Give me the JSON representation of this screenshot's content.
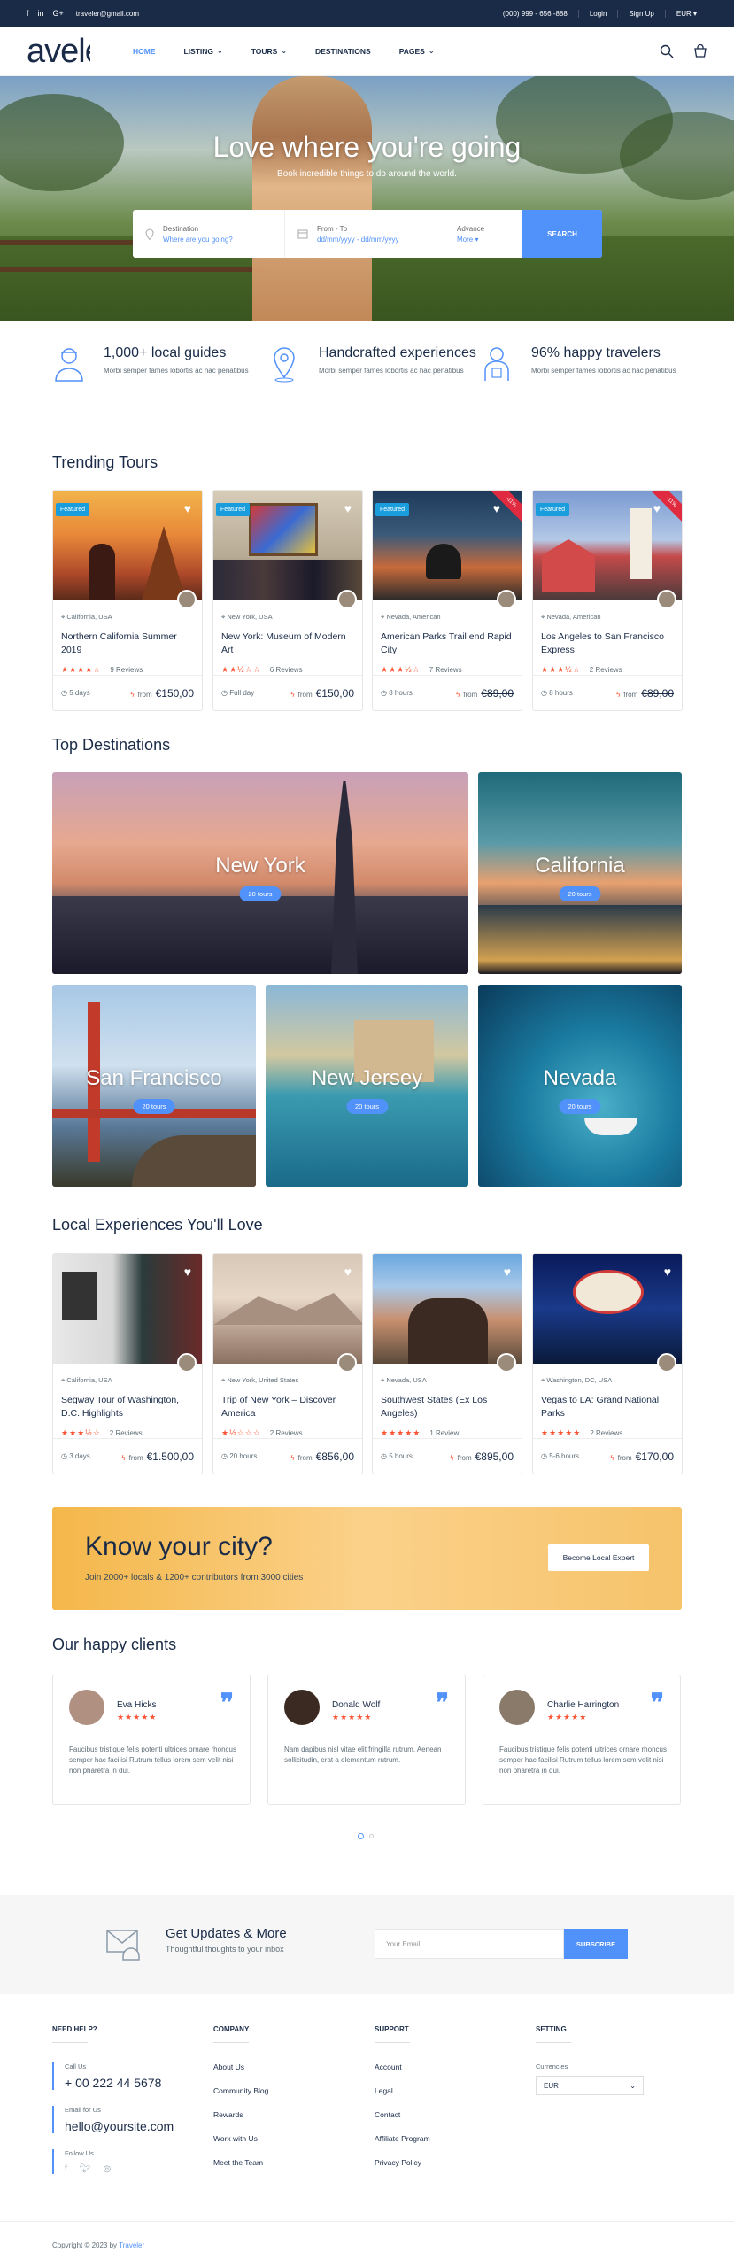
{
  "topbar": {
    "email": "traveler@gmail.com",
    "phone": "(000) 999 - 656 -888",
    "login": "Login",
    "signup": "Sign Up",
    "currency": "EUR"
  },
  "header": {
    "logo": "aveler",
    "nav": [
      "HOME",
      "LISTING",
      "TOURS",
      "DESTINATIONS",
      "PAGES"
    ]
  },
  "hero": {
    "title": "Love where you're going",
    "subtitle": "Book incredible things to do around the world.",
    "destination_label": "Destination",
    "destination_value": "Where are you going?",
    "date_label": "From - To",
    "date_value": "dd/mm/yyyy - dd/mm/yyyy",
    "advance_label": "Advance",
    "advance_value": "More",
    "search_button": "SEARCH"
  },
  "features": [
    {
      "title": "1,000+ local guides",
      "text": "Morbi semper fames lobortis ac hac penatibus"
    },
    {
      "title": "Handcrafted experiences",
      "text": "Morbi semper fames lobortis ac hac penatibus"
    },
    {
      "title": "96% happy travelers",
      "text": "Morbi semper fames lobortis ac hac penatibus"
    }
  ],
  "trending": {
    "title": "Trending Tours",
    "cards": [
      {
        "badge": "Featured",
        "location": "California, USA",
        "name": "Northern California Summer 2019",
        "reviews": "9 Reviews",
        "duration": "5 days",
        "from": "from",
        "price": "€150,00",
        "rating": 4
      },
      {
        "badge": "Featured",
        "location": "New York, USA",
        "name": "New York: Museum of Modern Art",
        "reviews": "6 Reviews",
        "duration": "Full day",
        "from": "from",
        "price": "€150,00",
        "rating": 2.5
      },
      {
        "badge": "Featured",
        "location": "Nevada, American",
        "name": "American Parks Trail end Rapid City",
        "reviews": "7 Reviews",
        "duration": "8 hours",
        "from": "from",
        "price": "€89,00",
        "rating": 3.5,
        "sale": "-11%"
      },
      {
        "badge": "Featured",
        "location": "Nevada, American",
        "name": "Los Angeles to San Francisco Express",
        "reviews": "2 Reviews",
        "duration": "8 hours",
        "from": "from",
        "price": "€89,00",
        "rating": 3.5,
        "sale": "-11%"
      }
    ]
  },
  "destinations": {
    "title": "Top Destinations",
    "items": [
      {
        "name": "New York",
        "tours": "20 tours"
      },
      {
        "name": "California",
        "tours": "20 tours"
      },
      {
        "name": "San Francisco",
        "tours": "20 tours"
      },
      {
        "name": "New Jersey",
        "tours": "20 tours"
      },
      {
        "name": "Nevada",
        "tours": "20 tours"
      }
    ]
  },
  "experiences": {
    "title": "Local Experiences You'll Love",
    "cards": [
      {
        "location": "California, USA",
        "name": "Segway Tour of Washington, D.C. Highlights",
        "reviews": "2 Reviews",
        "duration": "3 days",
        "from": "from",
        "price": "€1.500,00",
        "rating": 3.5
      },
      {
        "location": "New York, United States",
        "name": "Trip of New York – Discover America",
        "reviews": "2 Reviews",
        "duration": "20 hours",
        "from": "from",
        "price": "€856,00",
        "rating": 1.5
      },
      {
        "location": "Nevada, USA",
        "name": "Southwest States (Ex Los Angeles)",
        "reviews": "1 Review",
        "duration": "5 hours",
        "from": "from",
        "price": "€895,00",
        "rating": 5
      },
      {
        "location": "Washington, DC, USA",
        "name": "Vegas to LA: Grand National Parks",
        "reviews": "2 Reviews",
        "duration": "5-6 hours",
        "from": "from",
        "price": "€170,00",
        "rating": 5
      }
    ]
  },
  "banner": {
    "title": "Know your city?",
    "text": "Join 2000+ locals & 1200+ contributors from 3000 cities",
    "button": "Become Local Expert"
  },
  "clients": {
    "title": "Our happy clients",
    "items": [
      {
        "name": "Eva Hicks",
        "text": "Faucibus tristique felis potenti ultrices ornare rhoncus semper hac facilisi Rutrum tellus lorem sem velit nisi non pharetra in dui."
      },
      {
        "name": "Donald Wolf",
        "text": "Nam dapibus nisl vitae elit fringilla rutrum. Aenean sollicitudin, erat a elementum rutrum."
      },
      {
        "name": "Charlie Harrington",
        "text": "Faucibus tristique felis potenti ultrices ornare rhoncus semper hac facilisi Rutrum tellus lorem sem velit nisi non pharetra in dui."
      }
    ]
  },
  "newsletter": {
    "title": "Get Updates & More",
    "subtitle": "Thoughtful thoughts to your inbox",
    "placeholder": "Your Email",
    "button": "SUBSCRIBE"
  },
  "footer": {
    "need_help": "NEED HELP?",
    "call_label": "Call Us",
    "call_value": "+ 00 222 44 5678",
    "email_label": "Email for Us",
    "email_value": "hello@yoursite.com",
    "follow_label": "Follow Us",
    "company_title": "COMPANY",
    "company_links": [
      "About Us",
      "Community Blog",
      "Rewards",
      "Work with Us",
      "Meet the Team"
    ],
    "support_title": "SUPPORT",
    "support_links": [
      "Account",
      "Legal",
      "Contact",
      "Affiliate Program",
      "Privacy Policy"
    ],
    "setting_title": "SETTING",
    "currencies_label": "Currencies",
    "currency_value": "EUR",
    "copyright": "Copyright © 2023 by",
    "copyright_brand": "Traveler"
  },
  "colors": {
    "primary": "#5191fa",
    "navy": "#1a2b48",
    "star": "#fa5636"
  }
}
